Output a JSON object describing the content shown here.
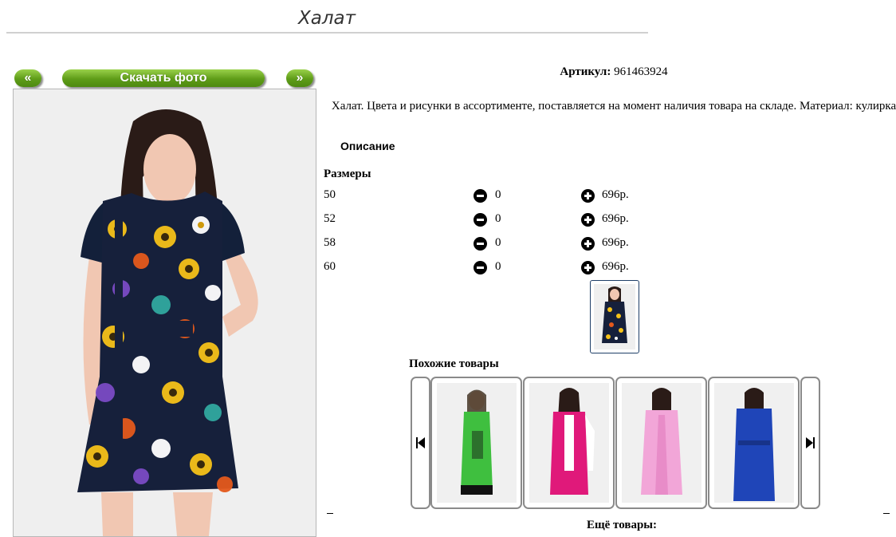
{
  "page": {
    "title": "Халат"
  },
  "gallery": {
    "prev_label": "«",
    "download_label": "Скачать фото",
    "next_label": "»"
  },
  "product": {
    "article_label": "Артикул:",
    "article_value": "961463924",
    "description": "Халат. Цвета и рисунки в ассортименте, поставляется на момент наличия товара на складе. Материал: кулирка",
    "description_label": "Описание"
  },
  "sizes": {
    "heading": "Размеры",
    "rows": [
      {
        "size": "50",
        "qty": "0",
        "price": "696р."
      },
      {
        "size": "52",
        "qty": "0",
        "price": "696р."
      },
      {
        "size": "58",
        "qty": "0",
        "price": "696р."
      },
      {
        "size": "60",
        "qty": "0",
        "price": "696р."
      }
    ]
  },
  "similar": {
    "heading": "Похожие товары",
    "items": [
      {
        "color": "#3fbf3f",
        "name": "green-dress"
      },
      {
        "color": "#e0197a",
        "name": "pink-vest-robe"
      },
      {
        "color": "#f2a6d8",
        "name": "light-pink-robe"
      },
      {
        "color": "#1f45b8",
        "name": "blue-robe"
      }
    ]
  },
  "more": {
    "label": "Ещё товары:"
  }
}
